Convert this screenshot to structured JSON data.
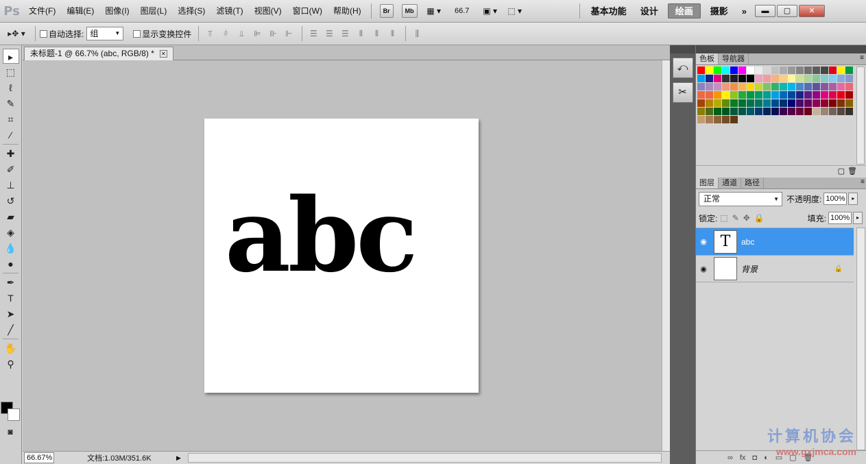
{
  "app": {
    "logo": "Ps"
  },
  "menu": {
    "items": [
      "文件(F)",
      "编辑(E)",
      "图像(I)",
      "图层(L)",
      "选择(S)",
      "滤镜(T)",
      "视图(V)",
      "窗口(W)",
      "帮助(H)"
    ],
    "br_label": "Br",
    "mb_label": "Mb",
    "zoom": "66.7"
  },
  "workspaces": {
    "items": [
      "基本功能",
      "设计",
      "绘画",
      "摄影"
    ],
    "active": "绘画",
    "more": "»"
  },
  "options": {
    "auto_select_label": "自动选择:",
    "auto_select_value": "组",
    "show_transform_label": "显示变换控件"
  },
  "document": {
    "tab_title": "未标题-1 @ 66.7% (abc, RGB/8) *",
    "text": "abc"
  },
  "status": {
    "zoom": "66.67%",
    "doc_info": "文档:1.03M/351.6K"
  },
  "swatches_panel": {
    "tabs": [
      "色板",
      "导航器"
    ]
  },
  "swatch_colors": [
    "#ff0000",
    "#ffff00",
    "#00ff00",
    "#00ffff",
    "#0000ff",
    "#ff00ff",
    "#ffffff",
    "#ebebeb",
    "#d6d6d6",
    "#c2c2c2",
    "#adadad",
    "#999999",
    "#858585",
    "#707070",
    "#5c5c5c",
    "#474747",
    "#e60012",
    "#fff100",
    "#009944",
    "#00a0e9",
    "#1d2088",
    "#e4007f",
    "#333333",
    "#1f1f1f",
    "#0a0a0a",
    "#000000",
    "#f19ec2",
    "#f29c9f",
    "#f6b37f",
    "#facd89",
    "#fff799",
    "#cce198",
    "#acd598",
    "#89c997",
    "#84ccc9",
    "#7ecef4",
    "#88abda",
    "#8c97cb",
    "#8f82bc",
    "#aa89bd",
    "#c490bf",
    "#f29b76",
    "#f19149",
    "#f8b551",
    "#ffd800",
    "#c2d92d",
    "#80c269",
    "#32b16c",
    "#13b5b1",
    "#00b7ee",
    "#448aca",
    "#556fb5",
    "#5f52a0",
    "#8957a1",
    "#ae5da1",
    "#ea68a2",
    "#eb6877",
    "#ec6941",
    "#ec6941",
    "#f39800",
    "#fff100",
    "#8fc31f",
    "#22ac38",
    "#009944",
    "#009b6b",
    "#009e96",
    "#00a0e9",
    "#0068b7",
    "#00479d",
    "#1d2088",
    "#601986",
    "#920783",
    "#e4007f",
    "#e5004f",
    "#e60012",
    "#a40000",
    "#a84200",
    "#b28500",
    "#b7aa00",
    "#638c0b",
    "#097c25",
    "#007130",
    "#00734c",
    "#007467",
    "#007c97",
    "#004b8b",
    "#00306e",
    "#040075",
    "#490b67",
    "#6a005f",
    "#8f0057",
    "#900028",
    "#7d0000",
    "#7e3200",
    "#846100",
    "#897f00",
    "#4d6a1b",
    "#005e15",
    "#00561f",
    "#005a3b",
    "#005649",
    "#005766",
    "#003b6d",
    "#00235a",
    "#0c0c53",
    "#3d004f",
    "#540046",
    "#6b0041",
    "#6a0019",
    "#c7b299",
    "#998675",
    "#736357",
    "#534741",
    "#37302b",
    "#c69c6e",
    "#a67c52",
    "#8c6239",
    "#754c24",
    "#603913"
  ],
  "layers_panel": {
    "tabs": [
      "图层",
      "通道",
      "路径"
    ],
    "blend_mode": "正常",
    "opacity_label": "不透明度:",
    "opacity": "100%",
    "lock_label": "锁定:",
    "fill_label": "填充:",
    "fill": "100%",
    "layers": [
      {
        "name": "abc",
        "thumb": "T",
        "selected": true
      },
      {
        "name": "背景",
        "thumb": "",
        "selected": false
      }
    ]
  },
  "watermark": {
    "text": "计算机协会",
    "url": "www.gxjmca.com"
  }
}
